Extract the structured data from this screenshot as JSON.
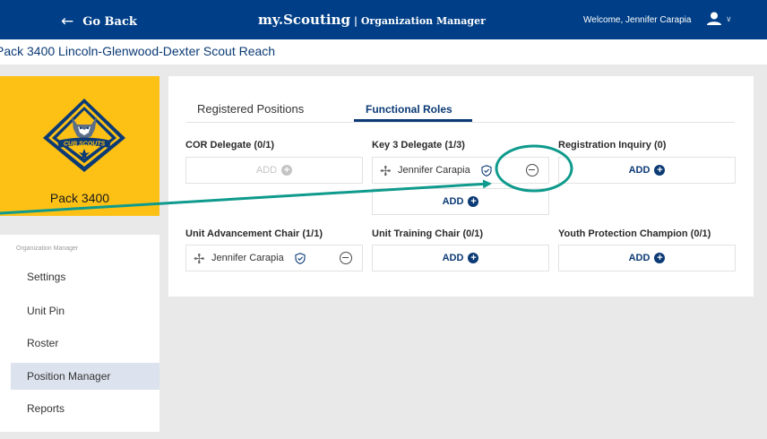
{
  "header": {
    "back_label": "Go Back",
    "brand": "my.Scouting",
    "brand_sub": "| Organization Manager",
    "welcome": "Welcome, Jennifer Carapia"
  },
  "unit_title": "Pack 3400 Lincoln-Glenwood-Dexter Scout Reach",
  "sidebar": {
    "logo_text": "CUB SCOUTS",
    "pack_name": "Pack 3400",
    "section_caption": "Organization Manager",
    "items": [
      {
        "label": "Settings"
      },
      {
        "label": "Unit Pin"
      },
      {
        "label": "Roster"
      },
      {
        "label": "Position Manager",
        "active": true
      },
      {
        "label": "Reports"
      }
    ]
  },
  "tabs": [
    {
      "label": "Registered Positions"
    },
    {
      "label": "Functional Roles",
      "active": true
    }
  ],
  "add_label": "ADD",
  "roles": [
    {
      "title": "COR Delegate (0/1)"
    },
    {
      "title": "Key 3 Delegate (1/3)",
      "member": "Jennifer Carapia"
    },
    {
      "title": "Registration Inquiry (0)"
    },
    {
      "title": "Unit Advancement Chair (1/1)",
      "member": "Jennifer Carapia"
    },
    {
      "title": "Unit Training Chair (0/1)"
    },
    {
      "title": "Youth Protection Champion (0/1)"
    }
  ],
  "colors": {
    "header_bg": "#003f87",
    "brand_navy": "#0b3a75",
    "cub_yellow": "#fdc116",
    "annotation_teal": "#0e9a8c"
  },
  "icons": [
    "arrow-left-icon",
    "user-icon",
    "chevron-down-icon",
    "move-icon",
    "shield-check-icon",
    "minus-circle-icon",
    "plus-circle-icon"
  ]
}
